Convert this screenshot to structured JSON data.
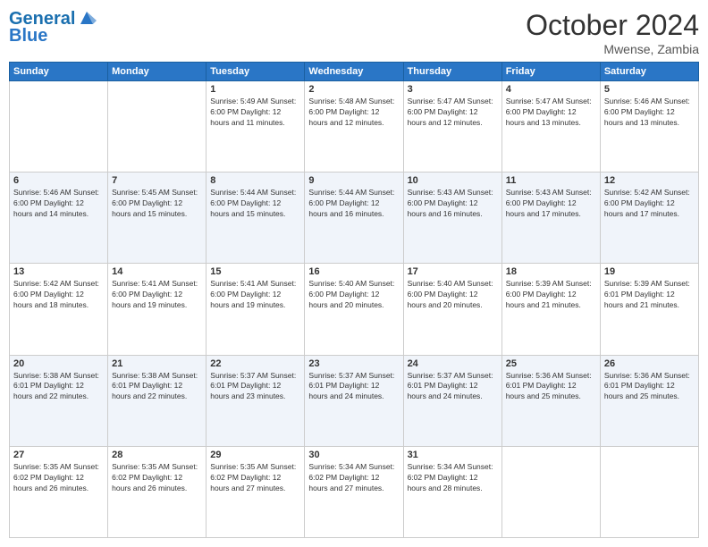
{
  "header": {
    "logo_line1": "General",
    "logo_line2": "Blue",
    "month": "October 2024",
    "location": "Mwense, Zambia"
  },
  "weekdays": [
    "Sunday",
    "Monday",
    "Tuesday",
    "Wednesday",
    "Thursday",
    "Friday",
    "Saturday"
  ],
  "weeks": [
    [
      {
        "day": "",
        "info": ""
      },
      {
        "day": "",
        "info": ""
      },
      {
        "day": "1",
        "info": "Sunrise: 5:49 AM\nSunset: 6:00 PM\nDaylight: 12 hours\nand 11 minutes."
      },
      {
        "day": "2",
        "info": "Sunrise: 5:48 AM\nSunset: 6:00 PM\nDaylight: 12 hours\nand 12 minutes."
      },
      {
        "day": "3",
        "info": "Sunrise: 5:47 AM\nSunset: 6:00 PM\nDaylight: 12 hours\nand 12 minutes."
      },
      {
        "day": "4",
        "info": "Sunrise: 5:47 AM\nSunset: 6:00 PM\nDaylight: 12 hours\nand 13 minutes."
      },
      {
        "day": "5",
        "info": "Sunrise: 5:46 AM\nSunset: 6:00 PM\nDaylight: 12 hours\nand 13 minutes."
      }
    ],
    [
      {
        "day": "6",
        "info": "Sunrise: 5:46 AM\nSunset: 6:00 PM\nDaylight: 12 hours\nand 14 minutes."
      },
      {
        "day": "7",
        "info": "Sunrise: 5:45 AM\nSunset: 6:00 PM\nDaylight: 12 hours\nand 15 minutes."
      },
      {
        "day": "8",
        "info": "Sunrise: 5:44 AM\nSunset: 6:00 PM\nDaylight: 12 hours\nand 15 minutes."
      },
      {
        "day": "9",
        "info": "Sunrise: 5:44 AM\nSunset: 6:00 PM\nDaylight: 12 hours\nand 16 minutes."
      },
      {
        "day": "10",
        "info": "Sunrise: 5:43 AM\nSunset: 6:00 PM\nDaylight: 12 hours\nand 16 minutes."
      },
      {
        "day": "11",
        "info": "Sunrise: 5:43 AM\nSunset: 6:00 PM\nDaylight: 12 hours\nand 17 minutes."
      },
      {
        "day": "12",
        "info": "Sunrise: 5:42 AM\nSunset: 6:00 PM\nDaylight: 12 hours\nand 17 minutes."
      }
    ],
    [
      {
        "day": "13",
        "info": "Sunrise: 5:42 AM\nSunset: 6:00 PM\nDaylight: 12 hours\nand 18 minutes."
      },
      {
        "day": "14",
        "info": "Sunrise: 5:41 AM\nSunset: 6:00 PM\nDaylight: 12 hours\nand 19 minutes."
      },
      {
        "day": "15",
        "info": "Sunrise: 5:41 AM\nSunset: 6:00 PM\nDaylight: 12 hours\nand 19 minutes."
      },
      {
        "day": "16",
        "info": "Sunrise: 5:40 AM\nSunset: 6:00 PM\nDaylight: 12 hours\nand 20 minutes."
      },
      {
        "day": "17",
        "info": "Sunrise: 5:40 AM\nSunset: 6:00 PM\nDaylight: 12 hours\nand 20 minutes."
      },
      {
        "day": "18",
        "info": "Sunrise: 5:39 AM\nSunset: 6:00 PM\nDaylight: 12 hours\nand 21 minutes."
      },
      {
        "day": "19",
        "info": "Sunrise: 5:39 AM\nSunset: 6:01 PM\nDaylight: 12 hours\nand 21 minutes."
      }
    ],
    [
      {
        "day": "20",
        "info": "Sunrise: 5:38 AM\nSunset: 6:01 PM\nDaylight: 12 hours\nand 22 minutes."
      },
      {
        "day": "21",
        "info": "Sunrise: 5:38 AM\nSunset: 6:01 PM\nDaylight: 12 hours\nand 22 minutes."
      },
      {
        "day": "22",
        "info": "Sunrise: 5:37 AM\nSunset: 6:01 PM\nDaylight: 12 hours\nand 23 minutes."
      },
      {
        "day": "23",
        "info": "Sunrise: 5:37 AM\nSunset: 6:01 PM\nDaylight: 12 hours\nand 24 minutes."
      },
      {
        "day": "24",
        "info": "Sunrise: 5:37 AM\nSunset: 6:01 PM\nDaylight: 12 hours\nand 24 minutes."
      },
      {
        "day": "25",
        "info": "Sunrise: 5:36 AM\nSunset: 6:01 PM\nDaylight: 12 hours\nand 25 minutes."
      },
      {
        "day": "26",
        "info": "Sunrise: 5:36 AM\nSunset: 6:01 PM\nDaylight: 12 hours\nand 25 minutes."
      }
    ],
    [
      {
        "day": "27",
        "info": "Sunrise: 5:35 AM\nSunset: 6:02 PM\nDaylight: 12 hours\nand 26 minutes."
      },
      {
        "day": "28",
        "info": "Sunrise: 5:35 AM\nSunset: 6:02 PM\nDaylight: 12 hours\nand 26 minutes."
      },
      {
        "day": "29",
        "info": "Sunrise: 5:35 AM\nSunset: 6:02 PM\nDaylight: 12 hours\nand 27 minutes."
      },
      {
        "day": "30",
        "info": "Sunrise: 5:34 AM\nSunset: 6:02 PM\nDaylight: 12 hours\nand 27 minutes."
      },
      {
        "day": "31",
        "info": "Sunrise: 5:34 AM\nSunset: 6:02 PM\nDaylight: 12 hours\nand 28 minutes."
      },
      {
        "day": "",
        "info": ""
      },
      {
        "day": "",
        "info": ""
      }
    ]
  ]
}
